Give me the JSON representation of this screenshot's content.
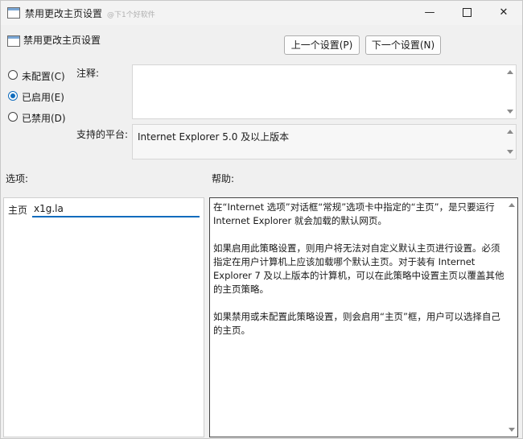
{
  "window": {
    "title": "禁用更改主页设置",
    "watermark": "@下1个好软件",
    "controls": {
      "minimize": "—",
      "close": "✕"
    }
  },
  "header": {
    "title": "禁用更改主页设置"
  },
  "nav": {
    "prev_label": "上一个设置(P)",
    "next_label": "下一个设置(N)"
  },
  "state": {
    "options": [
      {
        "label": "未配置(C)",
        "selected": false
      },
      {
        "label": "已启用(E)",
        "selected": true
      },
      {
        "label": "已禁用(D)",
        "selected": false
      }
    ]
  },
  "comment": {
    "label": "注释:",
    "value": ""
  },
  "platform": {
    "label": "支持的平台:",
    "value": "Internet Explorer 5.0 及以上版本"
  },
  "options_section": {
    "label": "选项:",
    "homepage_label": "主页",
    "homepage_value": "x1g.la"
  },
  "help_section": {
    "label": "帮助:",
    "paragraphs": [
      "在“Internet 选项”对话框“常规”选项卡中指定的“主页”，是只要运行 Internet Explorer 就会加载的默认网页。",
      "如果启用此策略设置，则用户将无法对自定义默认主页进行设置。必须指定在用户计算机上应该加载哪个默认主页。对于装有 Internet Explorer 7 及以上版本的计算机，可以在此策略中设置主页以覆盖其他的主页策略。",
      "如果禁用或未配置此策略设置，则会启用“主页”框，用户可以选择自己的主页。"
    ]
  }
}
